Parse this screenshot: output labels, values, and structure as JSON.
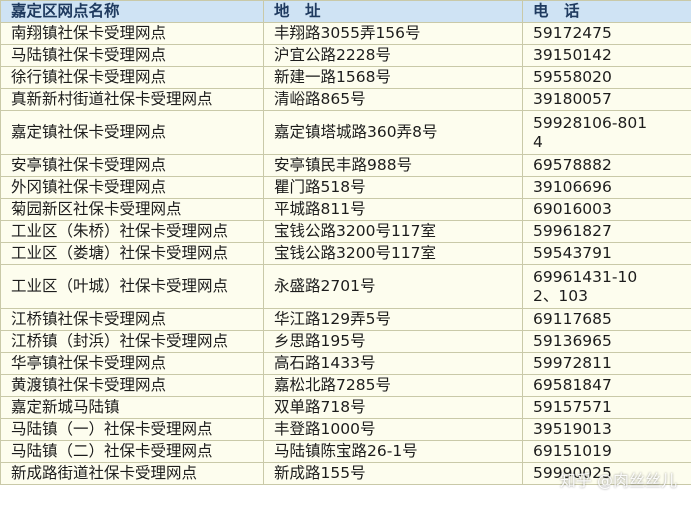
{
  "table": {
    "headers": [
      "嘉定区网点名称",
      "地　址",
      "电　话"
    ],
    "rows": [
      [
        "南翔镇社保卡受理网点",
        "丰翔路3055弄156号",
        "59172475"
      ],
      [
        "马陆镇社保卡受理网点",
        "沪宜公路2228号",
        "39150142"
      ],
      [
        "徐行镇社保卡受理网点",
        "新建一路1568号",
        "59558020"
      ],
      [
        "真新新村街道社保卡受理网点",
        "清峪路865号",
        "39180057"
      ],
      [
        "嘉定镇社保卡受理网点",
        "嘉定镇塔城路360弄8号",
        "59928106-8014"
      ],
      [
        "安亭镇社保卡受理网点",
        "安亭镇民丰路988号",
        "69578882"
      ],
      [
        "外冈镇社保卡受理网点",
        "瞿门路518号",
        "39106696"
      ],
      [
        "菊园新区社保卡受理网点",
        "平城路811号",
        "69016003"
      ],
      [
        "工业区（朱桥）社保卡受理网点",
        "宝钱公路3200号117室",
        "59961827"
      ],
      [
        "工业区（娄塘）社保卡受理网点",
        "宝钱公路3200号117室",
        "59543791"
      ],
      [
        "工业区（叶城）社保卡受理网点",
        "永盛路2701号",
        "69961431-102、103"
      ],
      [
        "江桥镇社保卡受理网点",
        "华江路129弄5号",
        "69117685"
      ],
      [
        "江桥镇（封浜）社保卡受理网点",
        "乡思路195号",
        "59136965"
      ],
      [
        "华亭镇社保卡受理网点",
        "高石路1433号",
        "59972811"
      ],
      [
        "黄渡镇社保卡受理网点",
        "嘉松北路7285号",
        "69581847"
      ],
      [
        "嘉定新城马陆镇",
        "双单路718号",
        "59157571"
      ],
      [
        "马陆镇（一）社保卡受理网点",
        "丰登路1000号",
        "39519013"
      ],
      [
        "马陆镇（二）社保卡受理网点",
        "马陆镇陈宝路26-1号",
        "69151019"
      ],
      [
        "新成路街道社保卡受理网点",
        "新成路155号",
        "59990025"
      ]
    ]
  },
  "watermark": "知乎 @肉丝丝儿"
}
